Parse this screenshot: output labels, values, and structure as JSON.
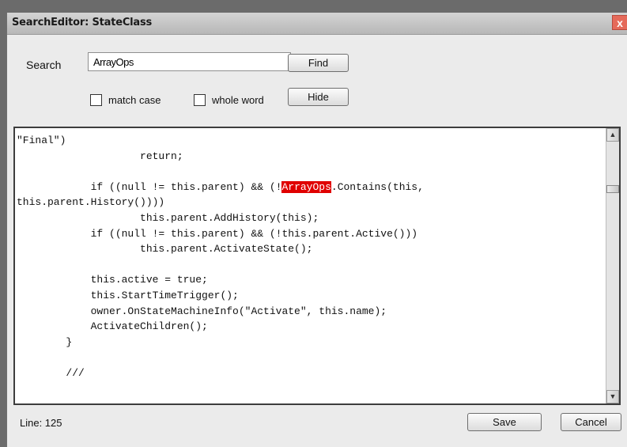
{
  "window": {
    "title": "SearchEditor: StateClass",
    "close_glyph": "x"
  },
  "search": {
    "label": "Search",
    "value": "ArrayOps",
    "find_label": "Find",
    "hide_label": "Hide"
  },
  "options": {
    "match_case_label": "match case",
    "whole_word_label": "whole word",
    "match_case_checked": false,
    "whole_word_checked": false
  },
  "editor": {
    "highlight_term": "ArrayOps",
    "lines": [
      "\"Final\")",
      "                    return;",
      "",
      "            if ((null != this.parent) && (!ArrayOps.Contains(this,",
      "this.parent.History())))",
      "                    this.parent.AddHistory(this);",
      "            if ((null != this.parent) && (!this.parent.Active()))",
      "                    this.parent.ActivateState();",
      "",
      "            this.active = true;",
      "            this.StartTimeTrigger();",
      "            owner.OnStateMachineInfo(\"Activate\", this.name);",
      "            ActivateChildren();",
      "        }",
      "",
      "        ///"
    ]
  },
  "icons": {
    "close": "close-icon",
    "scroll_up": "chevron-up-icon",
    "scroll_down": "chevron-down-icon"
  },
  "colors": {
    "highlight": "#e00000",
    "close_button": "#e56a5a"
  },
  "footer": {
    "line_status": "Line: 125",
    "save_label": "Save",
    "cancel_label": "Cancel"
  }
}
